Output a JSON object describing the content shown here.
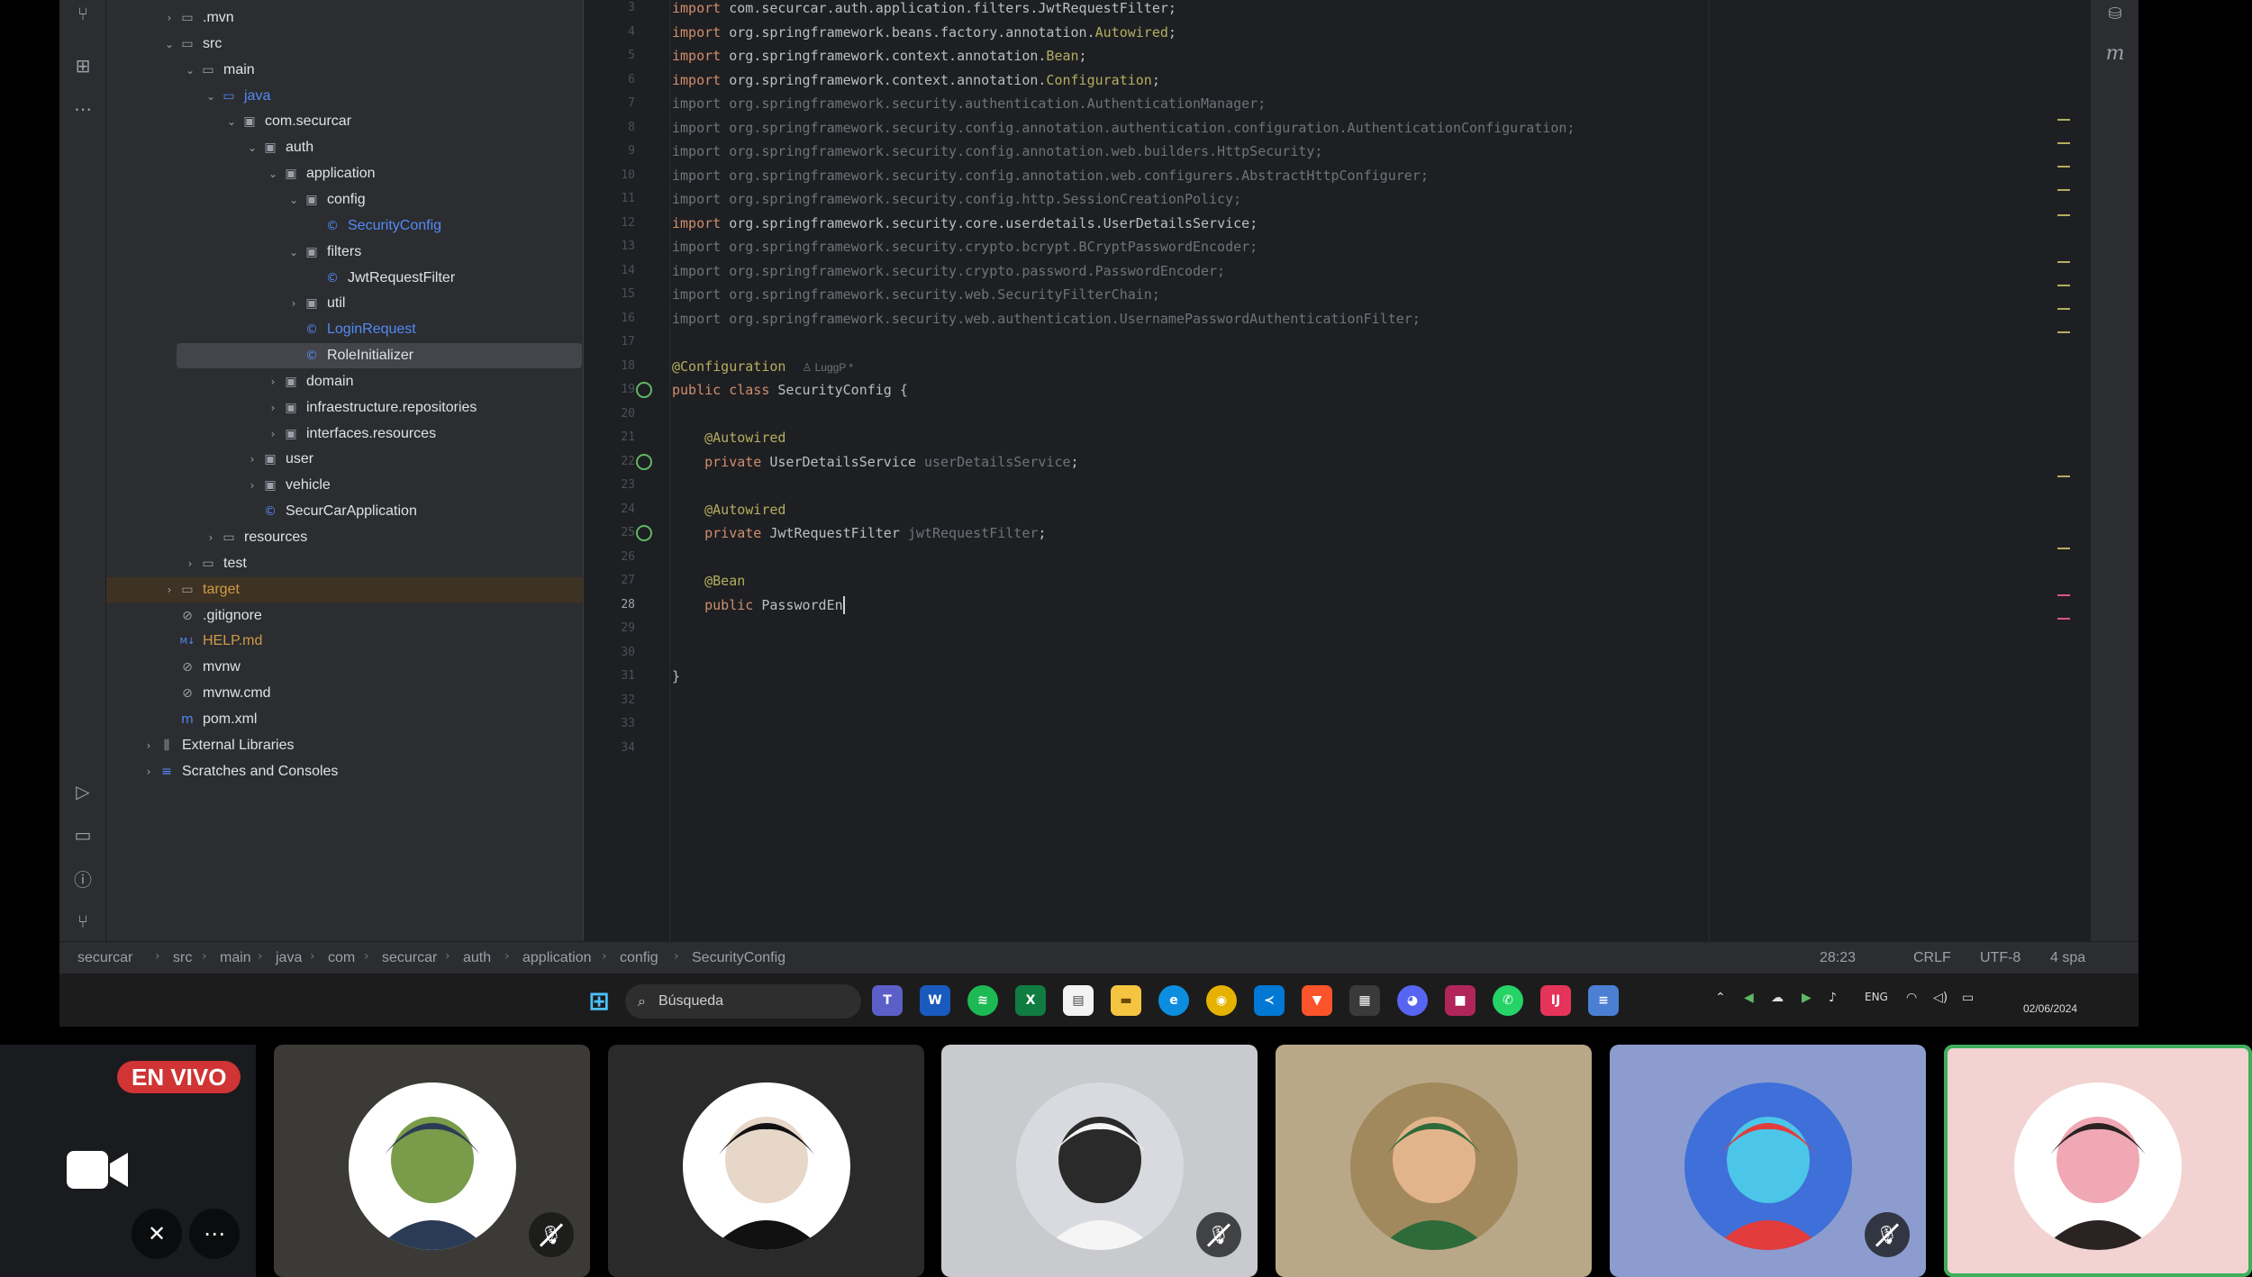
{
  "sidebar_icons": [
    "git-icon",
    "structure-icon",
    "more-icon",
    "run-icon",
    "terminal-icon",
    "problems-icon",
    "vcs-icon"
  ],
  "project_tree": [
    {
      "label": ".mvn",
      "type": "folder",
      "depth": 1,
      "expanded": false
    },
    {
      "label": "src",
      "type": "folder",
      "depth": 1,
      "expanded": true
    },
    {
      "label": "main",
      "type": "folder",
      "depth": 2,
      "expanded": true
    },
    {
      "label": "java",
      "type": "source-folder",
      "depth": 3,
      "expanded": true
    },
    {
      "label": "com.securcar",
      "type": "package",
      "depth": 4,
      "expanded": true
    },
    {
      "label": "auth",
      "type": "package",
      "depth": 5,
      "expanded": true
    },
    {
      "label": "application",
      "type": "package",
      "depth": 6,
      "expanded": true
    },
    {
      "label": "config",
      "type": "package",
      "depth": 7,
      "expanded": true
    },
    {
      "label": "SecurityConfig",
      "type": "class",
      "depth": 8,
      "color": "blue"
    },
    {
      "label": "filters",
      "type": "package",
      "depth": 7,
      "expanded": true
    },
    {
      "label": "JwtRequestFilter",
      "type": "class",
      "depth": 8
    },
    {
      "label": "util",
      "type": "package",
      "depth": 7,
      "expanded": false
    },
    {
      "label": "LoginRequest",
      "type": "class",
      "depth": 7,
      "color": "blue"
    },
    {
      "label": "RoleInitializer",
      "type": "class",
      "depth": 7,
      "selected": true
    },
    {
      "label": "domain",
      "type": "package",
      "depth": 6,
      "expanded": false
    },
    {
      "label": "infraestructure.repositories",
      "type": "package",
      "depth": 6,
      "expanded": false
    },
    {
      "label": "interfaces.resources",
      "type": "package",
      "depth": 6,
      "expanded": false
    },
    {
      "label": "user",
      "type": "package",
      "depth": 5,
      "expanded": false
    },
    {
      "label": "vehicle",
      "type": "package",
      "depth": 5,
      "expanded": false
    },
    {
      "label": "SecurCarApplication",
      "type": "class",
      "depth": 5
    },
    {
      "label": "resources",
      "type": "folder",
      "depth": 3,
      "expanded": false
    },
    {
      "label": "test",
      "type": "folder",
      "depth": 2,
      "expanded": false
    },
    {
      "label": "target",
      "type": "folder",
      "depth": 1,
      "expanded": false,
      "excluded": true
    },
    {
      "label": ".gitignore",
      "type": "file",
      "depth": 1
    },
    {
      "label": "HELP.md",
      "type": "md",
      "depth": 1
    },
    {
      "label": "mvnw",
      "type": "file",
      "depth": 1
    },
    {
      "label": "mvnw.cmd",
      "type": "file",
      "depth": 1
    },
    {
      "label": "pom.xml",
      "type": "maven",
      "depth": 1
    },
    {
      "label": "External Libraries",
      "type": "libs",
      "depth": 0,
      "expanded": false
    },
    {
      "label": "Scratches and Consoles",
      "type": "scratch",
      "depth": 0,
      "expanded": false
    }
  ],
  "editor": {
    "lines": [
      {
        "n": "3",
        "tokens": [
          [
            "kw",
            "import "
          ],
          [
            "",
            "com.securcar.auth.application.filters.JwtRequestFilter;"
          ]
        ]
      },
      {
        "n": "4",
        "tokens": [
          [
            "kw",
            "import "
          ],
          [
            "",
            "org.springframework.beans.factory.annotation."
          ],
          [
            "ann",
            "Autowired"
          ],
          [
            "",
            ";"
          ]
        ]
      },
      {
        "n": "5",
        "tokens": [
          [
            "kw",
            "import "
          ],
          [
            "",
            "org.springframework.context.annotation."
          ],
          [
            "ann",
            "Bean"
          ],
          [
            "",
            ";"
          ]
        ]
      },
      {
        "n": "6",
        "tokens": [
          [
            "kw",
            "import "
          ],
          [
            "",
            "org.springframework.context.annotation."
          ],
          [
            "ann",
            "Configuration"
          ],
          [
            "",
            ";"
          ]
        ]
      },
      {
        "n": "7",
        "tokens": [
          [
            "dim",
            "import org.springframework.security.authentication.AuthenticationManager;"
          ]
        ]
      },
      {
        "n": "8",
        "tokens": [
          [
            "dim",
            "import org.springframework.security.config.annotation.authentication.configuration.AuthenticationConfiguration;"
          ]
        ]
      },
      {
        "n": "9",
        "tokens": [
          [
            "dim",
            "import org.springframework.security.config.annotation.web.builders.HttpSecurity;"
          ]
        ]
      },
      {
        "n": "10",
        "tokens": [
          [
            "dim",
            "import org.springframework.security.config.annotation.web.configurers.AbstractHttpConfigurer;"
          ]
        ]
      },
      {
        "n": "11",
        "tokens": [
          [
            "dim",
            "import org.springframework.security.config.http.SessionCreationPolicy;"
          ]
        ]
      },
      {
        "n": "12",
        "tokens": [
          [
            "kw",
            "import "
          ],
          [
            "",
            "org.springframework.security.core.userdetails.UserDetailsService;"
          ]
        ]
      },
      {
        "n": "13",
        "tokens": [
          [
            "dim",
            "import org.springframework.security.crypto.bcrypt.BCryptPasswordEncoder;"
          ]
        ]
      },
      {
        "n": "14",
        "tokens": [
          [
            "dim",
            "import org.springframework.security.crypto.password.PasswordEncoder;"
          ]
        ]
      },
      {
        "n": "15",
        "tokens": [
          [
            "dim",
            "import org.springframework.security.web.SecurityFilterChain;"
          ]
        ]
      },
      {
        "n": "16",
        "tokens": [
          [
            "dim",
            "import org.springframework.security.web.authentication.UsernamePasswordAuthenticationFilter;"
          ]
        ]
      },
      {
        "n": "17",
        "tokens": []
      },
      {
        "n": "18",
        "tokens": [
          [
            "ann",
            "@Configuration"
          ],
          [
            "",
            "  "
          ],
          [
            "author",
            "♙ LuggP *"
          ]
        ]
      },
      {
        "n": "19",
        "tokens": [
          [
            "kw",
            "public class "
          ],
          [
            "",
            "SecurityConfig {"
          ]
        ],
        "gutter": true
      },
      {
        "n": "20",
        "tokens": []
      },
      {
        "n": "21",
        "tokens": [
          [
            "",
            "    "
          ],
          [
            "ann",
            "@Autowired"
          ]
        ]
      },
      {
        "n": "22",
        "tokens": [
          [
            "",
            "    "
          ],
          [
            "kw",
            "private "
          ],
          [
            "",
            "UserDetailsService "
          ],
          [
            "fld",
            "userDetailsService"
          ],
          [
            "",
            ";"
          ]
        ],
        "gutter": true
      },
      {
        "n": "23",
        "tokens": []
      },
      {
        "n": "24",
        "tokens": [
          [
            "",
            "    "
          ],
          [
            "ann",
            "@Autowired"
          ]
        ]
      },
      {
        "n": "25",
        "tokens": [
          [
            "",
            "    "
          ],
          [
            "kw",
            "private "
          ],
          [
            "",
            "JwtRequestFilter "
          ],
          [
            "fld",
            "jwtRequestFilter"
          ],
          [
            "",
            ";"
          ]
        ],
        "gutter": true
      },
      {
        "n": "26",
        "tokens": []
      },
      {
        "n": "27",
        "tokens": [
          [
            "",
            "    "
          ],
          [
            "ann",
            "@Bean"
          ]
        ]
      },
      {
        "n": "28",
        "tokens": [
          [
            "",
            "    "
          ],
          [
            "kw",
            "public "
          ],
          [
            "",
            "PasswordEn"
          ]
        ],
        "current": true,
        "caret": true
      },
      {
        "n": "29",
        "tokens": []
      },
      {
        "n": "30",
        "tokens": []
      },
      {
        "n": "31",
        "tokens": [
          [
            "",
            "}"
          ]
        ]
      },
      {
        "n": "32",
        "tokens": []
      },
      {
        "n": "33",
        "tokens": []
      },
      {
        "n": "34",
        "tokens": []
      }
    ]
  },
  "breadcrumb": [
    "securcar",
    "src",
    "main",
    "java",
    "com",
    "securcar",
    "auth",
    "application",
    "config",
    "SecurityConfig"
  ],
  "status": {
    "position": "28:23",
    "line_ending": "CRLF",
    "encoding": "UTF-8",
    "indent": "4 spa"
  },
  "taskbar": {
    "search_placeholder": "Búsqueda",
    "tray_lang": "ENG",
    "date": "02/06/2024"
  },
  "call": {
    "live_label": "EN VIVO",
    "participants": [
      {
        "bg": "#3b3a36",
        "muted": true,
        "avatar": "yoda"
      },
      {
        "bg": "#2a2a2a",
        "muted": false,
        "avatar": "anime-boy"
      },
      {
        "bg": "#c8cacd",
        "muted": true,
        "avatar": "white-hair"
      },
      {
        "bg": "#b9a888",
        "muted": false,
        "avatar": "zoro"
      },
      {
        "bg": "#8d9ccf",
        "muted": true,
        "avatar": "boyfriend"
      },
      {
        "bg": "#f2d3d1",
        "muted": false,
        "avatar": "couple",
        "speaking": true
      }
    ]
  }
}
